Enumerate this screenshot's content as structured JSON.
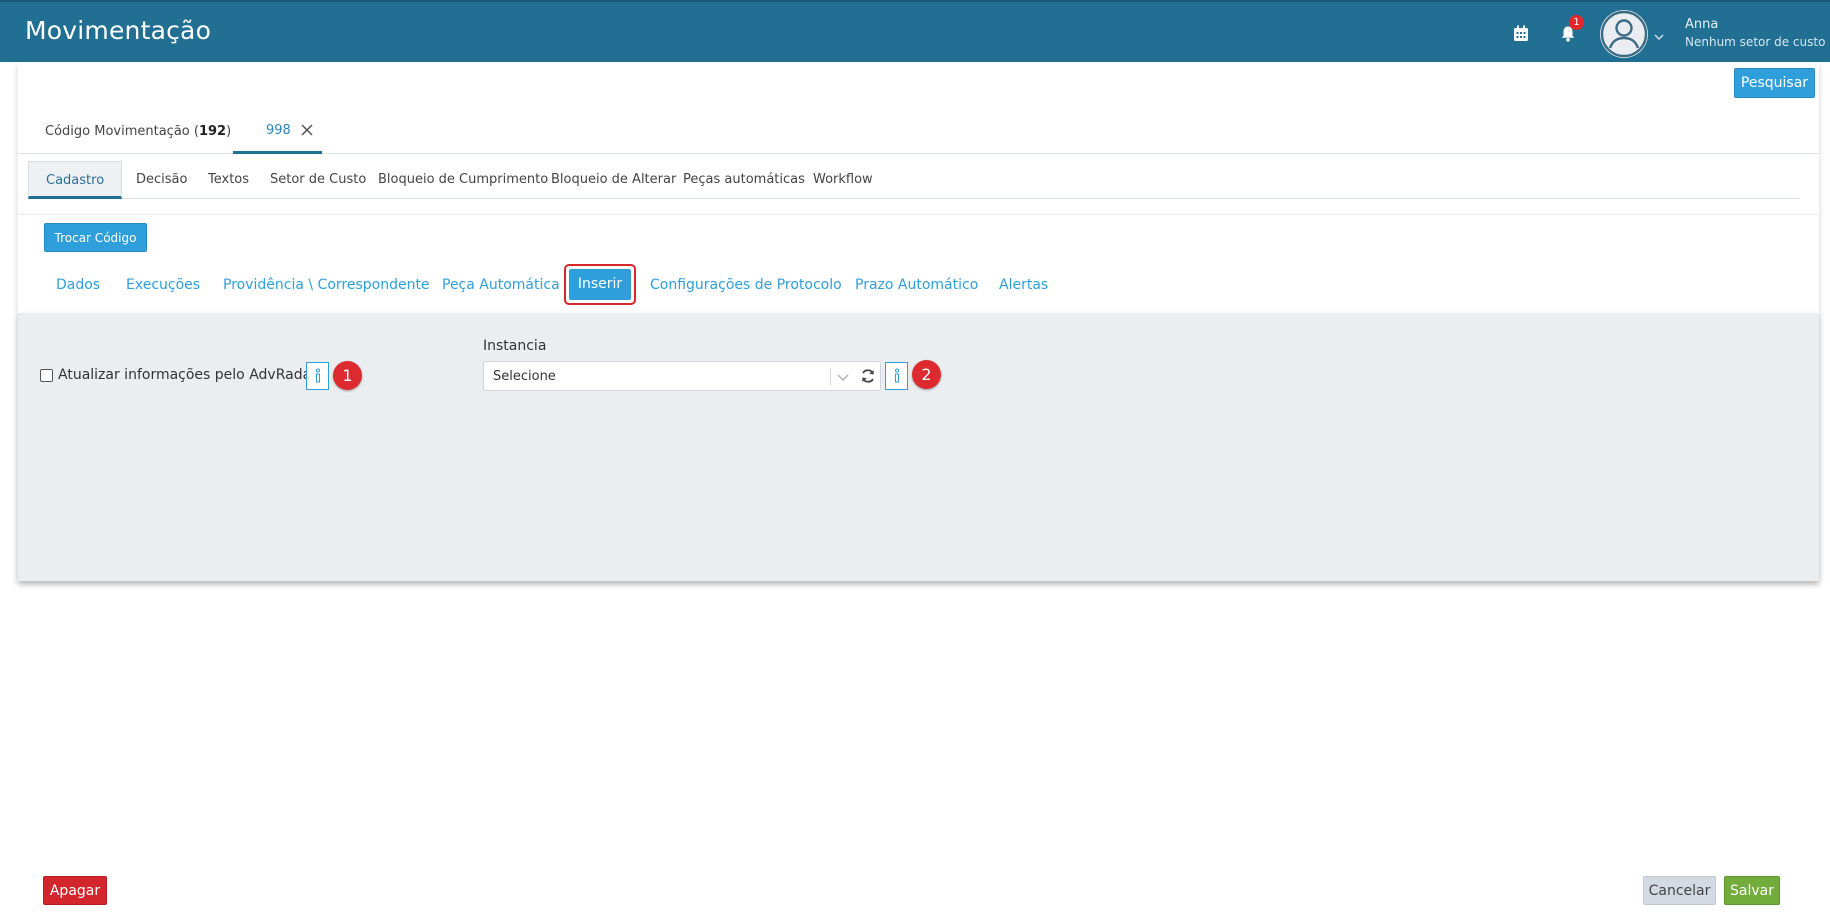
{
  "header": {
    "title": "Movimentação",
    "notification_count": "1",
    "user": {
      "name": "Anna",
      "sector": "Nenhum setor de custo"
    },
    "icons": {
      "calendar": "calendar-icon",
      "bell": "bell-icon",
      "avatar": "user-avatar-icon",
      "chevron": "chevron-down-icon"
    }
  },
  "toolbar": {
    "search_label": "Pesquisar"
  },
  "record_tabs": {
    "list_prefix": "Código Movimentação (",
    "list_count": "192",
    "list_suffix": ")",
    "active_code": "998"
  },
  "main_tabs": [
    {
      "label": "Cadastro",
      "active": true
    },
    {
      "label": "Decisão"
    },
    {
      "label": "Textos"
    },
    {
      "label": "Setor de Custo"
    },
    {
      "label": "Bloqueio de Cumprimento"
    },
    {
      "label": "Bloqueio de Alterar"
    },
    {
      "label": "Peças automáticas"
    },
    {
      "label": "Workflow"
    }
  ],
  "actions": {
    "trocar_codigo": "Trocar Código"
  },
  "sub_tabs": [
    {
      "label": "Dados"
    },
    {
      "label": "Execuções"
    },
    {
      "label": "Providência \\ Correspondente"
    },
    {
      "label": "Peça Automática"
    },
    {
      "label": "Inserir",
      "active": true
    },
    {
      "label": "Configurações de Protocolo"
    },
    {
      "label": "Prazo Automático"
    },
    {
      "label": "Alertas"
    }
  ],
  "form": {
    "advradar_checkbox": {
      "label": "Atualizar informações pelo AdvRadar",
      "checked": false
    },
    "instancia": {
      "label": "Instancia",
      "value": "Selecione"
    },
    "markers": [
      "1",
      "2"
    ]
  },
  "footer": {
    "delete_label": "Apagar",
    "cancel_label": "Cancelar",
    "save_label": "Salvar"
  },
  "colors": {
    "header_bg": "#226f94",
    "primary": "#2f9fdc",
    "danger": "#d2262c",
    "success": "#72ac3a",
    "highlight": "#d9262b"
  }
}
